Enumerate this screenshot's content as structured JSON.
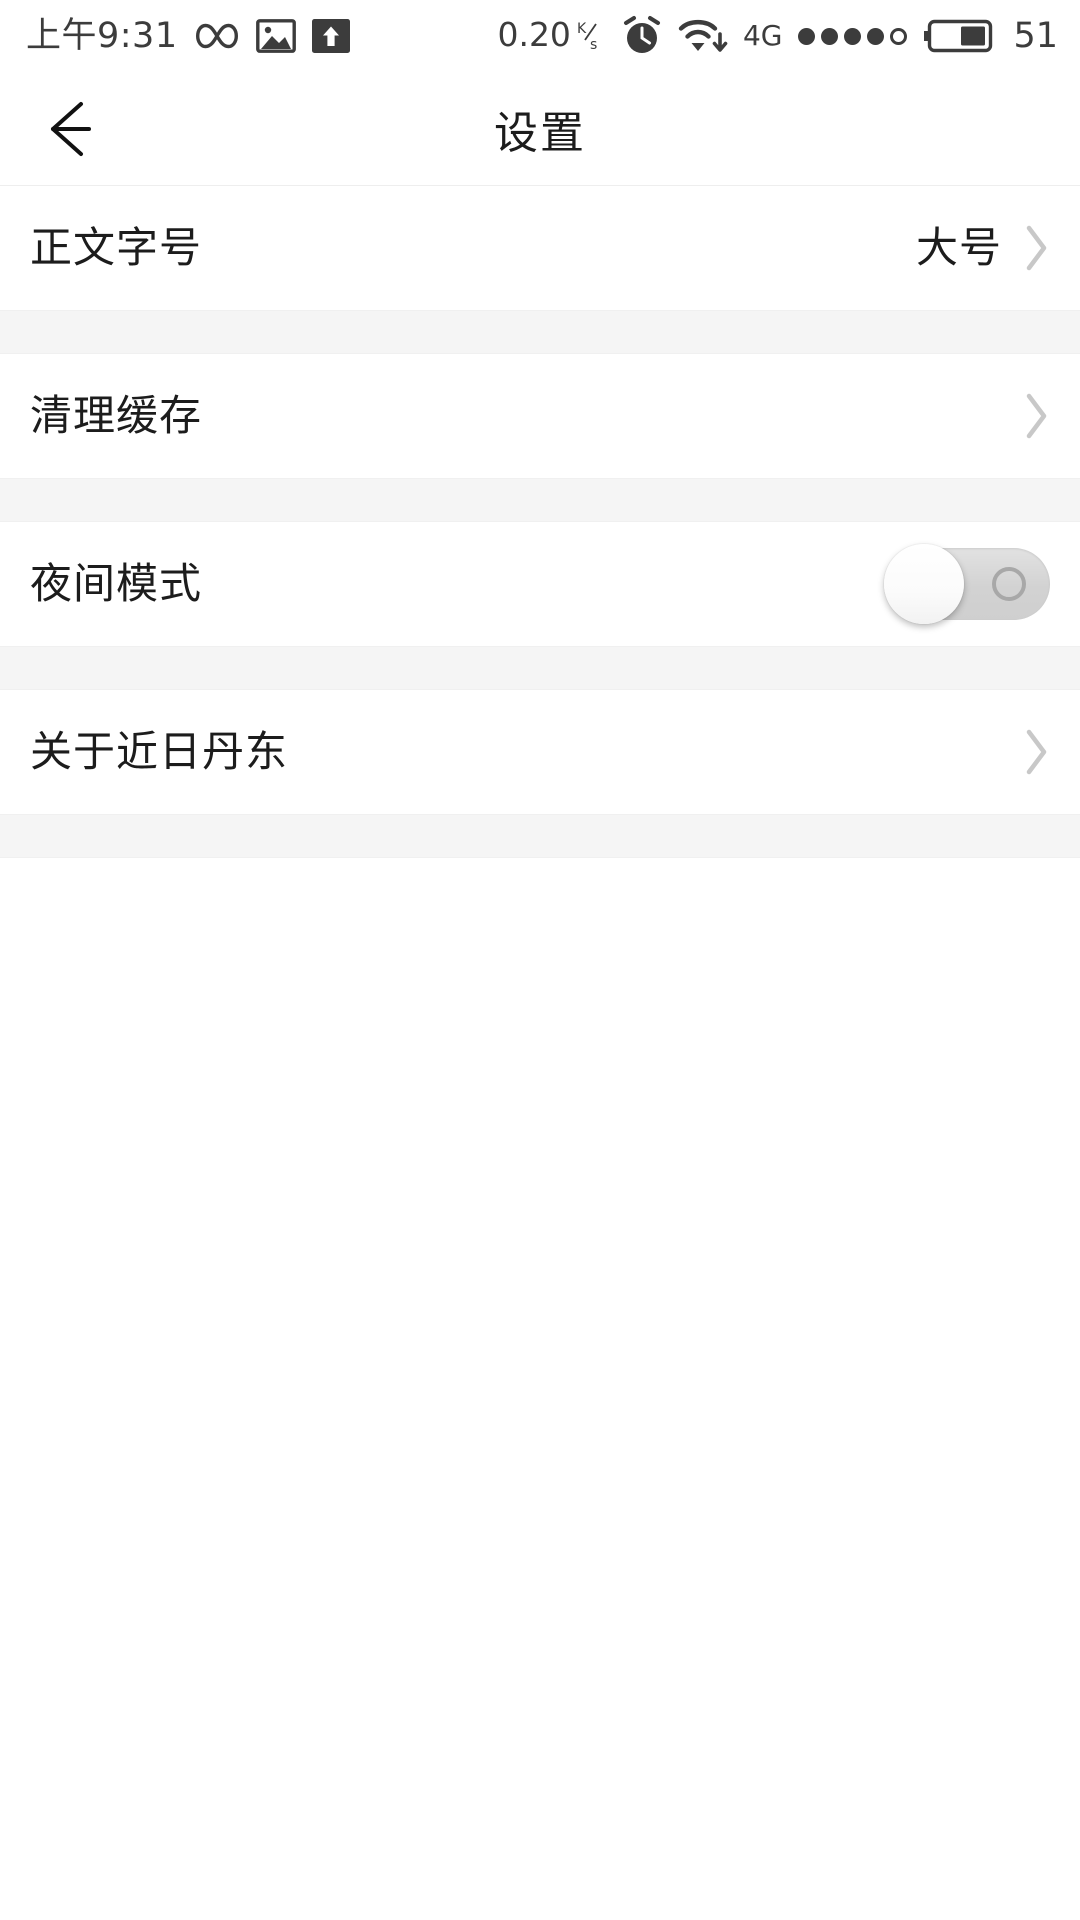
{
  "status_bar": {
    "clock": "上午9:31",
    "left_icons": [
      "infinity-icon",
      "image-icon",
      "upload-icon"
    ],
    "network_speed": "0.20",
    "network_speed_unit": "K/s",
    "network_speed_unit_num": "K",
    "network_speed_unit_den": "s",
    "alarm_icon": "alarm-clock-icon",
    "wifi_icon": "wifi-download-icon",
    "network_type": "4G",
    "signal_dots_filled": 4,
    "signal_dots_total": 5,
    "battery_icon": "battery-icon",
    "battery_level": "51",
    "battery_fill_percent": 51,
    "text_color": "#3c3c3c"
  },
  "header": {
    "back_icon": "back-arrow-icon",
    "title": "设置"
  },
  "settings": {
    "chevron_icon": "chevron-right-icon",
    "rows": [
      {
        "name": "body-font-size",
        "label": "正文字号",
        "value": "大号",
        "control": "chevron"
      },
      {
        "name": "clear-cache",
        "label": "清理缓存",
        "value": "",
        "control": "chevron"
      },
      {
        "name": "night-mode",
        "label": "夜间模式",
        "value": "",
        "control": "toggle",
        "toggle_state": "off"
      },
      {
        "name": "about-app",
        "label": "关于近日丹东",
        "value": "",
        "control": "chevron"
      }
    ]
  },
  "colors": {
    "page_background": "#ffffff",
    "row_background": "#ffffff",
    "separator_background": "#f5f5f5",
    "primary_text": "#1c1c1c",
    "chevron": "#c8c8c8",
    "toggle_track_off": "#d4d4d4",
    "toggle_thumb": "#ffffff"
  }
}
